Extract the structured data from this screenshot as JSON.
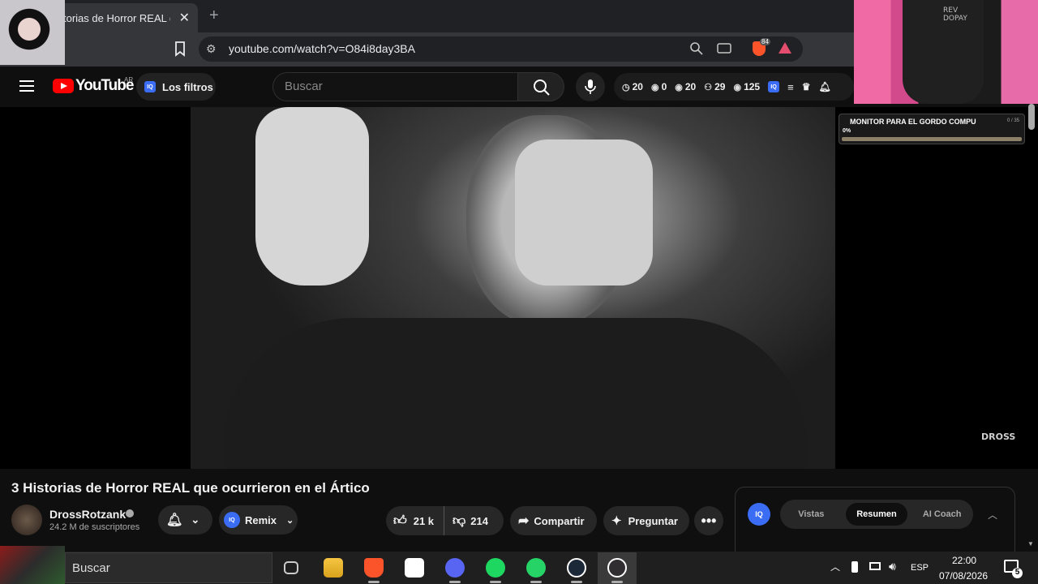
{
  "browser": {
    "tab_title": "torias de Horror REAL qu",
    "tab_close": "✕",
    "new_tab": "+",
    "url": "youtube.com/watch?v=O84i8day3BA",
    "brave_badge": "84"
  },
  "webcam_right": {
    "shirt_text": "REV DOPAY"
  },
  "header": {
    "logo_text": "YouTube",
    "country": "AR",
    "filters_label": "Los filtros",
    "iq_label": "IQ",
    "search_placeholder": "Buscar",
    "stats": [
      {
        "icon": "clock-icon",
        "glyph": "◷",
        "value": "20"
      },
      {
        "icon": "eye-icon",
        "glyph": "◉",
        "value": "0"
      },
      {
        "icon": "eye-icon",
        "glyph": "◉",
        "value": "20"
      },
      {
        "icon": "user-icon",
        "glyph": "⚇",
        "value": "29"
      },
      {
        "icon": "eye-icon",
        "glyph": "◉",
        "value": "125"
      }
    ]
  },
  "overlay": {
    "goal_title": "MONITOR PARA EL GORDO COMPU",
    "goal_count": "0 / 35",
    "goal_percent": "0%",
    "goal_progress": 0
  },
  "video": {
    "watermark": "DROSS",
    "title": "3 Historias de Horror REAL que ocurrieron en el Ártico"
  },
  "channel": {
    "name": "DrossRotzank",
    "subscribers": "24.2 M de suscriptores"
  },
  "actions": {
    "remix_label": "Remix",
    "likes": "21 k",
    "dislikes": "214",
    "share_label": "Compartir",
    "ask_label": "Preguntar",
    "more": "•••"
  },
  "side_panel": {
    "iq_label": "IQ",
    "tabs": [
      "Vistas",
      "Resumen",
      "AI Coach"
    ],
    "active_tab": "Resumen"
  },
  "taskbar": {
    "search_label": "Buscar",
    "language": "ESP",
    "time": "22:00",
    "date": "07/08/2026",
    "notifications": "5"
  },
  "colors": {
    "youtube_red": "#ff0000",
    "iq_blue": "#3a6cf4",
    "brave_orange": "#fb542b"
  }
}
